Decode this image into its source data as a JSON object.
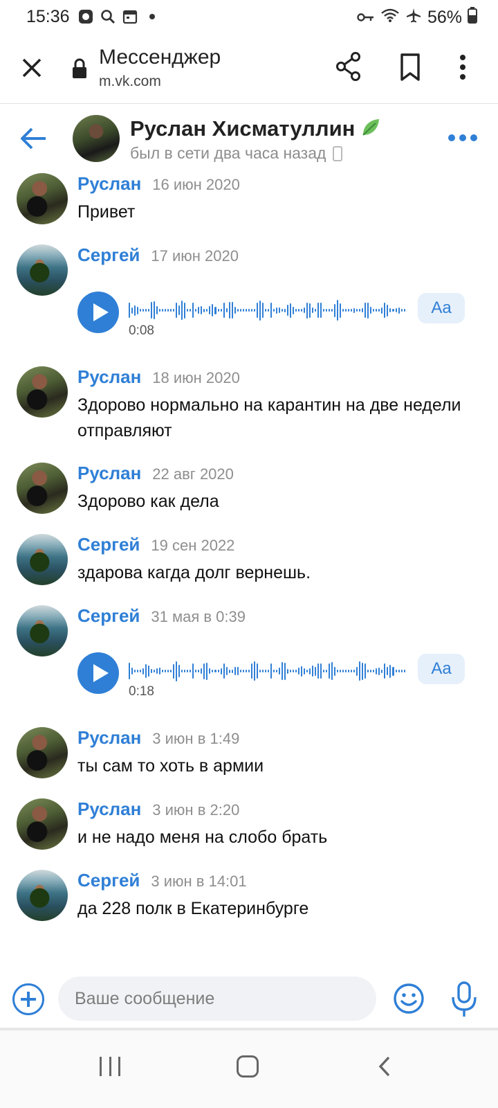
{
  "status_bar": {
    "time": "15:36",
    "battery": "56%",
    "icons": [
      "vk-notification-icon",
      "search-icon",
      "calendar-icon",
      "dot-icon",
      "vpn-key-icon",
      "wifi-icon",
      "airplane-icon",
      "battery-icon"
    ]
  },
  "browser": {
    "title": "Мессенджер",
    "url": "m.vk.com"
  },
  "chat": {
    "name": "Руслан Хисматуллин",
    "status": "был в сети два часа назад"
  },
  "messages": [
    {
      "author": "Руслан",
      "date": "16 июн 2020",
      "text": "Привет",
      "type": "text"
    },
    {
      "author": "Сергей",
      "date": "17 июн 2020",
      "type": "voice",
      "duration": "0:08",
      "transcribe": "Aa"
    },
    {
      "author": "Руслан",
      "date": "18 июн 2020",
      "text": "Здорово нормально на карантин на две недели отправляют",
      "type": "text"
    },
    {
      "author": "Руслан",
      "date": "22 авг 2020",
      "text": "Здорово как дела",
      "type": "text"
    },
    {
      "author": "Сергей",
      "date": "19 сен 2022",
      "text": "здарова кагда долг вернешь.",
      "type": "text"
    },
    {
      "author": "Сергей",
      "date": "31 мая в 0:39",
      "type": "voice",
      "duration": "0:18",
      "transcribe": "Aa"
    },
    {
      "author": "Руслан",
      "date": "3 июн в 1:49",
      "text": "ты сам то хоть в армии",
      "type": "text"
    },
    {
      "author": "Руслан",
      "date": "3 июн в 2:20",
      "text": "и не надо меня на слобо брать",
      "type": "text"
    },
    {
      "author": "Сергей",
      "date": "3 июн в 14:01",
      "text": "да 228 полк в Екатеринбурге",
      "type": "text"
    }
  ],
  "composer": {
    "placeholder": "Ваше сообщение"
  },
  "colors": {
    "accent": "#2f7fd6",
    "date_gray": "#8e8e8e"
  }
}
